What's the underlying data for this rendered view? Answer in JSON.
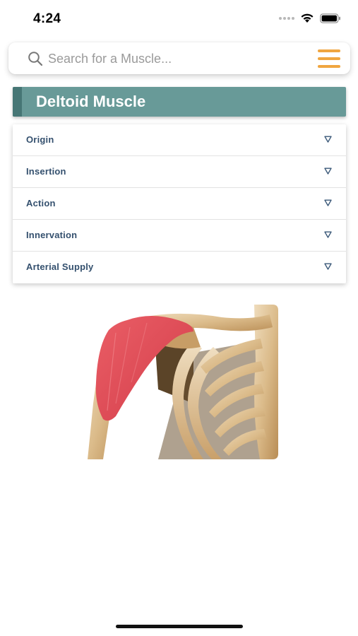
{
  "status_bar": {
    "time": "4:24"
  },
  "search": {
    "placeholder": "Search for a Muscle...",
    "value": "",
    "icon": "search-icon",
    "menu_icon": "hamburger-menu-icon"
  },
  "muscle": {
    "title": "Deltoid Muscle"
  },
  "sections": [
    {
      "label": "Origin",
      "icon": "chevron-down-icon"
    },
    {
      "label": "Insertion",
      "icon": "chevron-down-icon"
    },
    {
      "label": "Action",
      "icon": "chevron-down-icon"
    },
    {
      "label": "Innervation",
      "icon": "chevron-down-icon"
    },
    {
      "label": "Arterial Supply",
      "icon": "chevron-down-icon"
    }
  ],
  "colors": {
    "accent": "#f0a640",
    "banner": "#689a98",
    "banner_accent": "#467675",
    "section_text": "#34506e",
    "muscle_highlight": "#e0505a"
  }
}
